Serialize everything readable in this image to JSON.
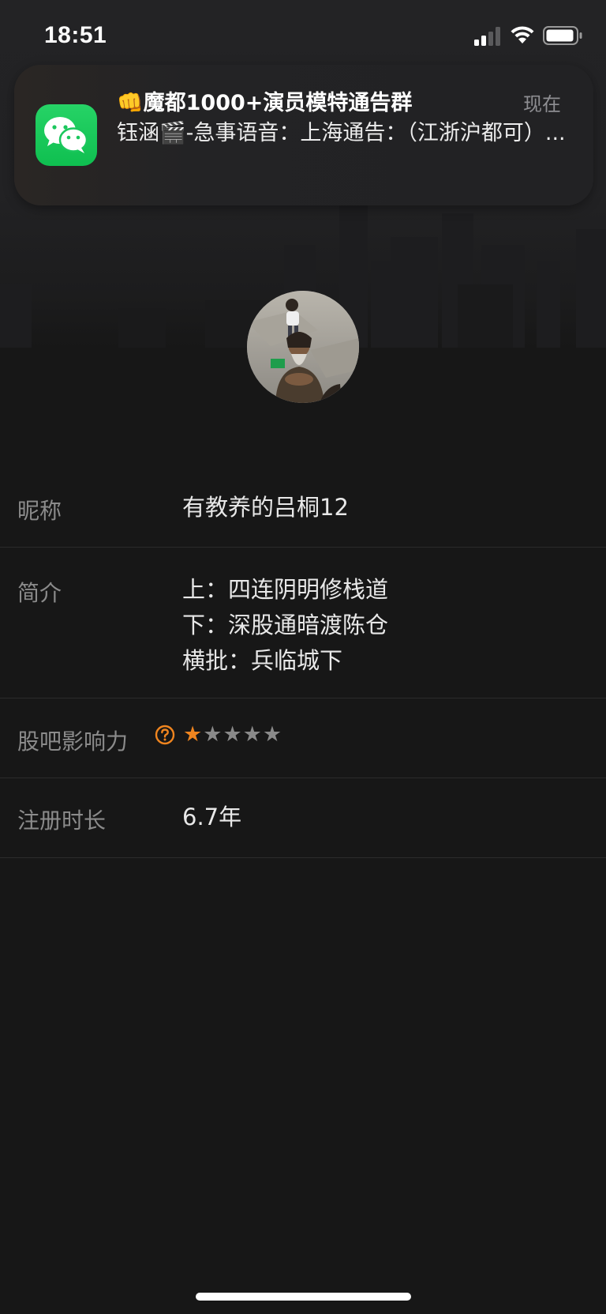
{
  "status_bar": {
    "time": "18:51",
    "signal_icon": "cellular-signal-icon",
    "wifi_icon": "wifi-icon",
    "battery_icon": "battery-icon"
  },
  "notification": {
    "app_icon": "wechat-icon",
    "title": "👊魔都1000+演员模特通告群",
    "time": "现在",
    "body": "钰涵🎬-急事语音：上海通告：（江浙沪都可）..."
  },
  "profile": {
    "avatar_icon": "user-avatar",
    "nickname_label": "昵称",
    "nickname": "有教养的吕桐12",
    "bio_label": "简介",
    "bio_line1": "上：四连阴明修栈道",
    "bio_line2": "下：深股通暗渡陈仓",
    "bio_line3": "横批：兵临城下",
    "influence_label": "股吧影响力",
    "influence_help_icon": "question-circle-icon",
    "influence_stars": 1,
    "influence_max": 5,
    "registration_label": "注册时长",
    "registration_value": "6.7年"
  },
  "colors": {
    "background": "#171717",
    "accent_orange": "#f0851f",
    "wechat_green": "#16c55a"
  }
}
